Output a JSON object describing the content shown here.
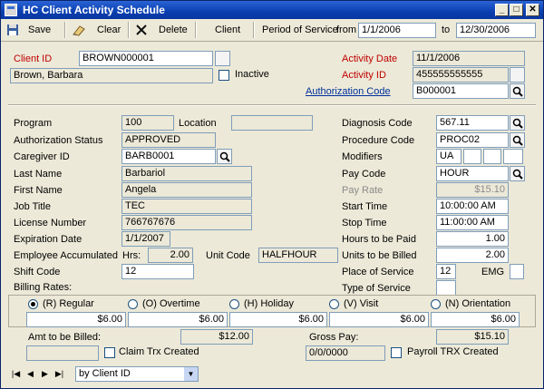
{
  "window": {
    "title": "HC Client Activity Schedule"
  },
  "toolbar": {
    "save": "Save",
    "clear": "Clear",
    "delete": "Delete",
    "client": "Client",
    "period_label": "Period of Service",
    "from_label": "from",
    "from_date": "1/1/2006",
    "to_label": "to",
    "to_date": "12/30/2006"
  },
  "header": {
    "client_id_label": "Client ID",
    "client_id": "BROWN000001",
    "client_name": "Brown, Barbara",
    "inactive_label": "Inactive",
    "activity_date_label": "Activity Date",
    "activity_date": "11/1/2006",
    "activity_id_label": "Activity ID",
    "activity_id": "455555555555",
    "auth_code_label": "Authorization Code",
    "auth_code": "B000001"
  },
  "left": {
    "program_label": "Program",
    "program": "100",
    "location_label": "Location",
    "location": "",
    "auth_status_label": "Authorization Status",
    "auth_status": "APPROVED",
    "caregiver_id_label": "Caregiver ID",
    "caregiver_id": "BARB0001",
    "last_name_label": "Last Name",
    "last_name": "Barbariol",
    "first_name_label": "First Name",
    "first_name": "Angela",
    "job_title_label": "Job Title",
    "job_title": "TEC",
    "license_label": "License Number",
    "license": "766767676",
    "expiration_label": "Expiration Date",
    "expiration": "1/1/2007",
    "emp_accum_label": "Employee Accumulated",
    "hrs_label": "Hrs:",
    "hrs": "2.00",
    "unit_code_label": "Unit Code",
    "unit_code": "HALFHOUR",
    "shift_code_label": "Shift Code",
    "shift_code": "12",
    "billing_rates_label": "Billing Rates:"
  },
  "right": {
    "diagnosis_label": "Diagnosis Code",
    "diagnosis": "567.11",
    "procedure_label": "Procedure Code",
    "procedure": "PROC02",
    "modifiers_label": "Modifiers",
    "modifier1": "UA",
    "pay_code_label": "Pay Code",
    "pay_code": "HOUR",
    "pay_rate_label": "Pay Rate",
    "pay_rate": "$15.10",
    "start_time_label": "Start Time",
    "start_time": "10:00:00 AM",
    "stop_time_label": "Stop Time",
    "stop_time": "11:00:00 AM",
    "hours_paid_label": "Hours to be Paid",
    "hours_paid": "1.00",
    "units_billed_label": "Units to be Billed",
    "units_billed": "2.00",
    "place_label": "Place of Service",
    "place": "12",
    "emg_label": "EMG",
    "type_label": "Type of Service"
  },
  "rates": [
    {
      "label": "(R) Regular",
      "value": "$6.00",
      "selected": true
    },
    {
      "label": "(O) Overtime",
      "value": "$6.00",
      "selected": false
    },
    {
      "label": "(H) Holiday",
      "value": "$6.00",
      "selected": false
    },
    {
      "label": "(V) Visit",
      "value": "$6.00",
      "selected": false
    },
    {
      "label": "(N) Orientation",
      "value": "$6.00",
      "selected": false
    }
  ],
  "footer": {
    "amt_billed_label": "Amt to be Billed:",
    "amt_billed": "$12.00",
    "claim_label": "Claim Trx Created",
    "gross_pay_label": "Gross Pay:",
    "gross_pay": "$15.10",
    "payroll_date": "0/0/0000",
    "payroll_label": "Payroll TRX Created"
  },
  "nav": {
    "sort": "by Client ID"
  },
  "colors": {
    "title_blue": "#0a3fb0",
    "required_red": "#c00000",
    "link_blue": "#00309c"
  }
}
